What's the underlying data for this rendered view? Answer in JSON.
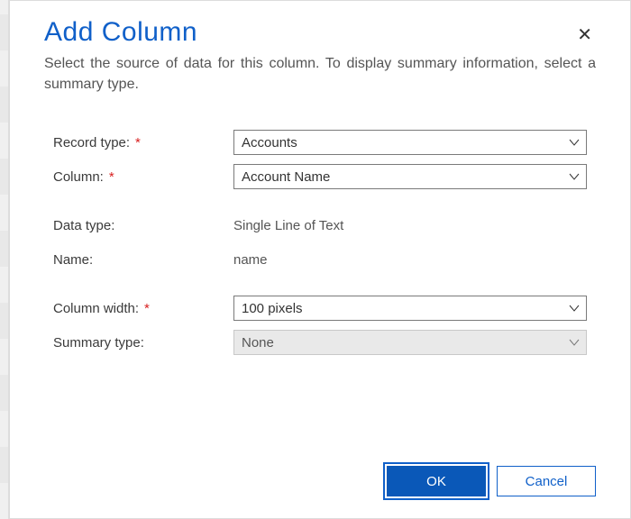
{
  "dialog": {
    "title": "Add Column",
    "description": "Select the source of data for this column. To display summary information, select a summary type.",
    "close_symbol": "✕"
  },
  "fields": {
    "record_type": {
      "label": "Record type:",
      "required": true,
      "value": "Accounts"
    },
    "column": {
      "label": "Column:",
      "required": true,
      "value": "Account Name"
    },
    "data_type": {
      "label": "Data type:",
      "value": "Single Line of Text"
    },
    "name": {
      "label": "Name:",
      "value": "name"
    },
    "column_width": {
      "label": "Column width:",
      "required": true,
      "value": "100 pixels"
    },
    "summary_type": {
      "label": "Summary type:",
      "value": "None",
      "disabled": true
    }
  },
  "buttons": {
    "ok": "OK",
    "cancel": "Cancel"
  },
  "required_marker": "*"
}
